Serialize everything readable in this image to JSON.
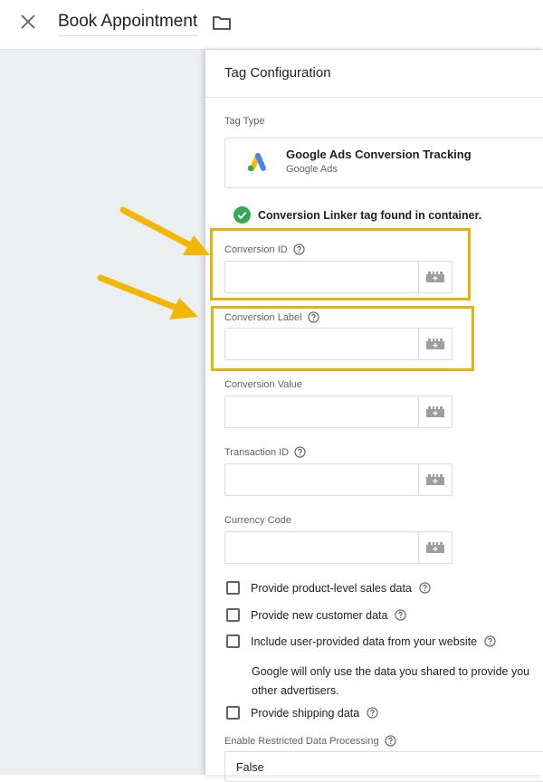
{
  "header": {
    "title": "Book Appointment"
  },
  "panel": {
    "title": "Tag Configuration",
    "tag_type_label": "Tag Type",
    "tag_type": {
      "name": "Google Ads Conversion Tracking",
      "subtitle": "Google Ads"
    },
    "linker_status": "Conversion Linker tag found in container.",
    "fields": [
      {
        "label": "Conversion ID",
        "value": ""
      },
      {
        "label": "Conversion Label",
        "value": ""
      },
      {
        "label": "Conversion Value",
        "value": ""
      },
      {
        "label": "Transaction ID",
        "value": ""
      },
      {
        "label": "Currency Code",
        "value": ""
      }
    ],
    "checkboxes": [
      {
        "label": "Provide product-level sales data",
        "checked": false
      },
      {
        "label": "Provide new customer data",
        "checked": false
      },
      {
        "label": "Include user-provided data from your website",
        "checked": false
      },
      {
        "label": "Provide shipping data",
        "checked": false
      }
    ],
    "user_data_note_line1": "Google will only use the data you shared to provide you",
    "user_data_note_line2": "other advertisers.",
    "restricted_label": "Enable Restricted Data Processing",
    "restricted_value": "False"
  },
  "colors": {
    "highlight": "#e8b10f",
    "arrow": "#f2b705",
    "check": "#34a853"
  },
  "icons": [
    "close-icon",
    "folder-icon",
    "google-ads-logo-icon",
    "check-circle-icon",
    "help-icon",
    "variable-picker-icon",
    "checkbox-icon",
    "annotation-arrow-icon"
  ]
}
